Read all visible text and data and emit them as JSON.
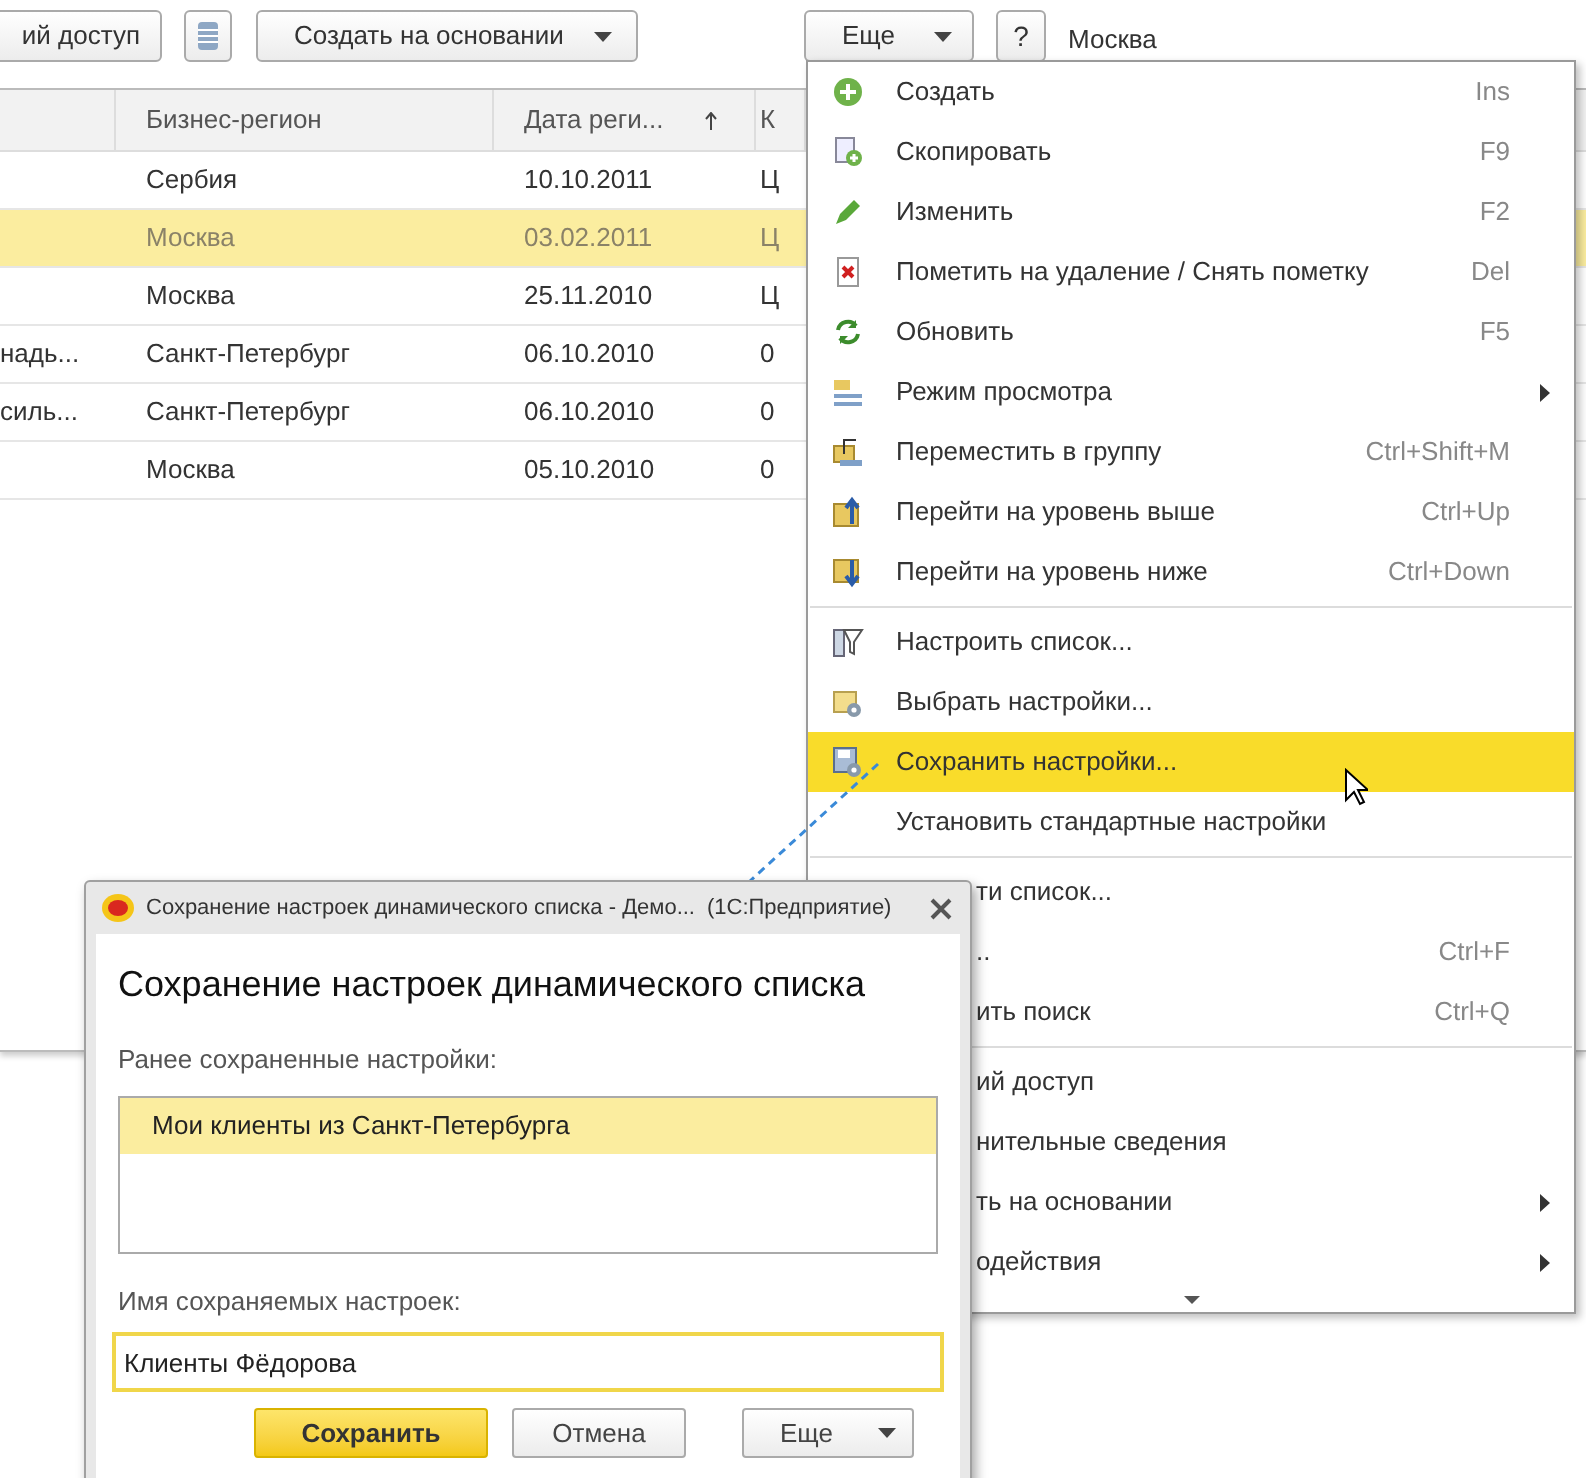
{
  "toolbar": {
    "access_button": "ий доступ",
    "create_based_button": "Создать на основании",
    "more_button": "Еще",
    "help_button": "?",
    "field_value": "Москва"
  },
  "table": {
    "columns": [
      {
        "sort": false
      },
      {
        "label": "Бизнес-регион",
        "sort": false
      },
      {
        "label": "Дата реги...",
        "sort": true
      },
      {
        "label": "К",
        "sort": false
      }
    ],
    "rows": [
      {
        "cells": [
          "",
          "Сербия",
          "10.10.2011",
          "Ц"
        ],
        "selected": false
      },
      {
        "cells": [
          "",
          "Москва",
          "03.02.2011",
          "Ц"
        ],
        "selected": true
      },
      {
        "cells": [
          "",
          "Москва",
          "25.11.2010",
          "Ц"
        ],
        "selected": false
      },
      {
        "cells": [
          "надь...",
          "Санкт-Петербург",
          "06.10.2010",
          "0"
        ],
        "selected": false
      },
      {
        "cells": [
          "силь...",
          "Санкт-Петербург",
          "06.10.2010",
          "0"
        ],
        "selected": false
      },
      {
        "cells": [
          "",
          "Москва",
          "05.10.2010",
          "0"
        ],
        "selected": false
      }
    ]
  },
  "menu": {
    "items": [
      {
        "kind": "item",
        "label": "Создать",
        "shortcut": "Ins",
        "submenu": false,
        "selected": false
      },
      {
        "kind": "item",
        "label": "Скопировать",
        "shortcut": "F9",
        "submenu": false,
        "selected": false
      },
      {
        "kind": "item",
        "label": "Изменить",
        "shortcut": "F2",
        "submenu": false,
        "selected": false
      },
      {
        "kind": "item",
        "label": "Пометить на удаление / Снять пометку",
        "shortcut": "Del",
        "submenu": false,
        "selected": false
      },
      {
        "kind": "item",
        "label": "Обновить",
        "shortcut": "F5",
        "submenu": false,
        "selected": false
      },
      {
        "kind": "item",
        "label": "Режим просмотра",
        "submenu": true,
        "selected": false
      },
      {
        "kind": "item",
        "label": "Переместить в группу",
        "shortcut": "Ctrl+Shift+M",
        "submenu": false,
        "selected": false
      },
      {
        "kind": "item",
        "label": "Перейти на уровень выше",
        "shortcut": "Ctrl+Up",
        "submenu": false,
        "selected": false
      },
      {
        "kind": "item",
        "label": "Перейти на уровень ниже",
        "shortcut": "Ctrl+Down",
        "submenu": false,
        "selected": false
      },
      {
        "kind": "separator"
      },
      {
        "kind": "item",
        "label": "Настроить список...",
        "submenu": false,
        "selected": false
      },
      {
        "kind": "item",
        "label": "Выбрать настройки...",
        "submenu": false,
        "selected": false
      },
      {
        "kind": "item",
        "label": "Сохранить настройки...",
        "submenu": false,
        "selected": true
      },
      {
        "kind": "item",
        "label": "Установить стандартные настройки",
        "submenu": false,
        "selected": false
      },
      {
        "kind": "separator"
      },
      {
        "kind": "covered",
        "label": "ти список...",
        "submenu": false,
        "selected": false
      },
      {
        "kind": "covered",
        "label": "..",
        "shortcut": "Ctrl+F",
        "submenu": false,
        "selected": false
      },
      {
        "kind": "covered",
        "label": "ить поиск",
        "shortcut": "Ctrl+Q",
        "submenu": false,
        "selected": false
      },
      {
        "kind": "separator"
      },
      {
        "kind": "covered",
        "label": "ий доступ",
        "submenu": false,
        "selected": false
      },
      {
        "kind": "covered",
        "label": "нительные сведения",
        "submenu": false,
        "selected": false
      },
      {
        "kind": "covered",
        "label": "ть на основании",
        "submenu": true,
        "selected": false
      },
      {
        "kind": "covered",
        "label": "одействия",
        "submenu": true,
        "selected": false
      }
    ]
  },
  "dialog": {
    "title": "Сохранение настроек динамического списка - Демо...",
    "title_app": "(1С:Предприятие)",
    "heading": "Сохранение настроек динамического списка",
    "saved_label": "Ранее сохраненные настройки:",
    "saved_items": [
      {
        "label": "Мои клиенты из Санкт-Петербурга",
        "selected": true
      }
    ],
    "name_label": "Имя сохраняемых настроек:",
    "name_value": "Клиенты Фёдорова",
    "buttons": [
      {
        "kind": "primary",
        "label": "Сохранить"
      },
      {
        "kind": "normal",
        "label": "Отмена"
      },
      {
        "kind": "dropdown",
        "label": "Еще"
      }
    ]
  }
}
